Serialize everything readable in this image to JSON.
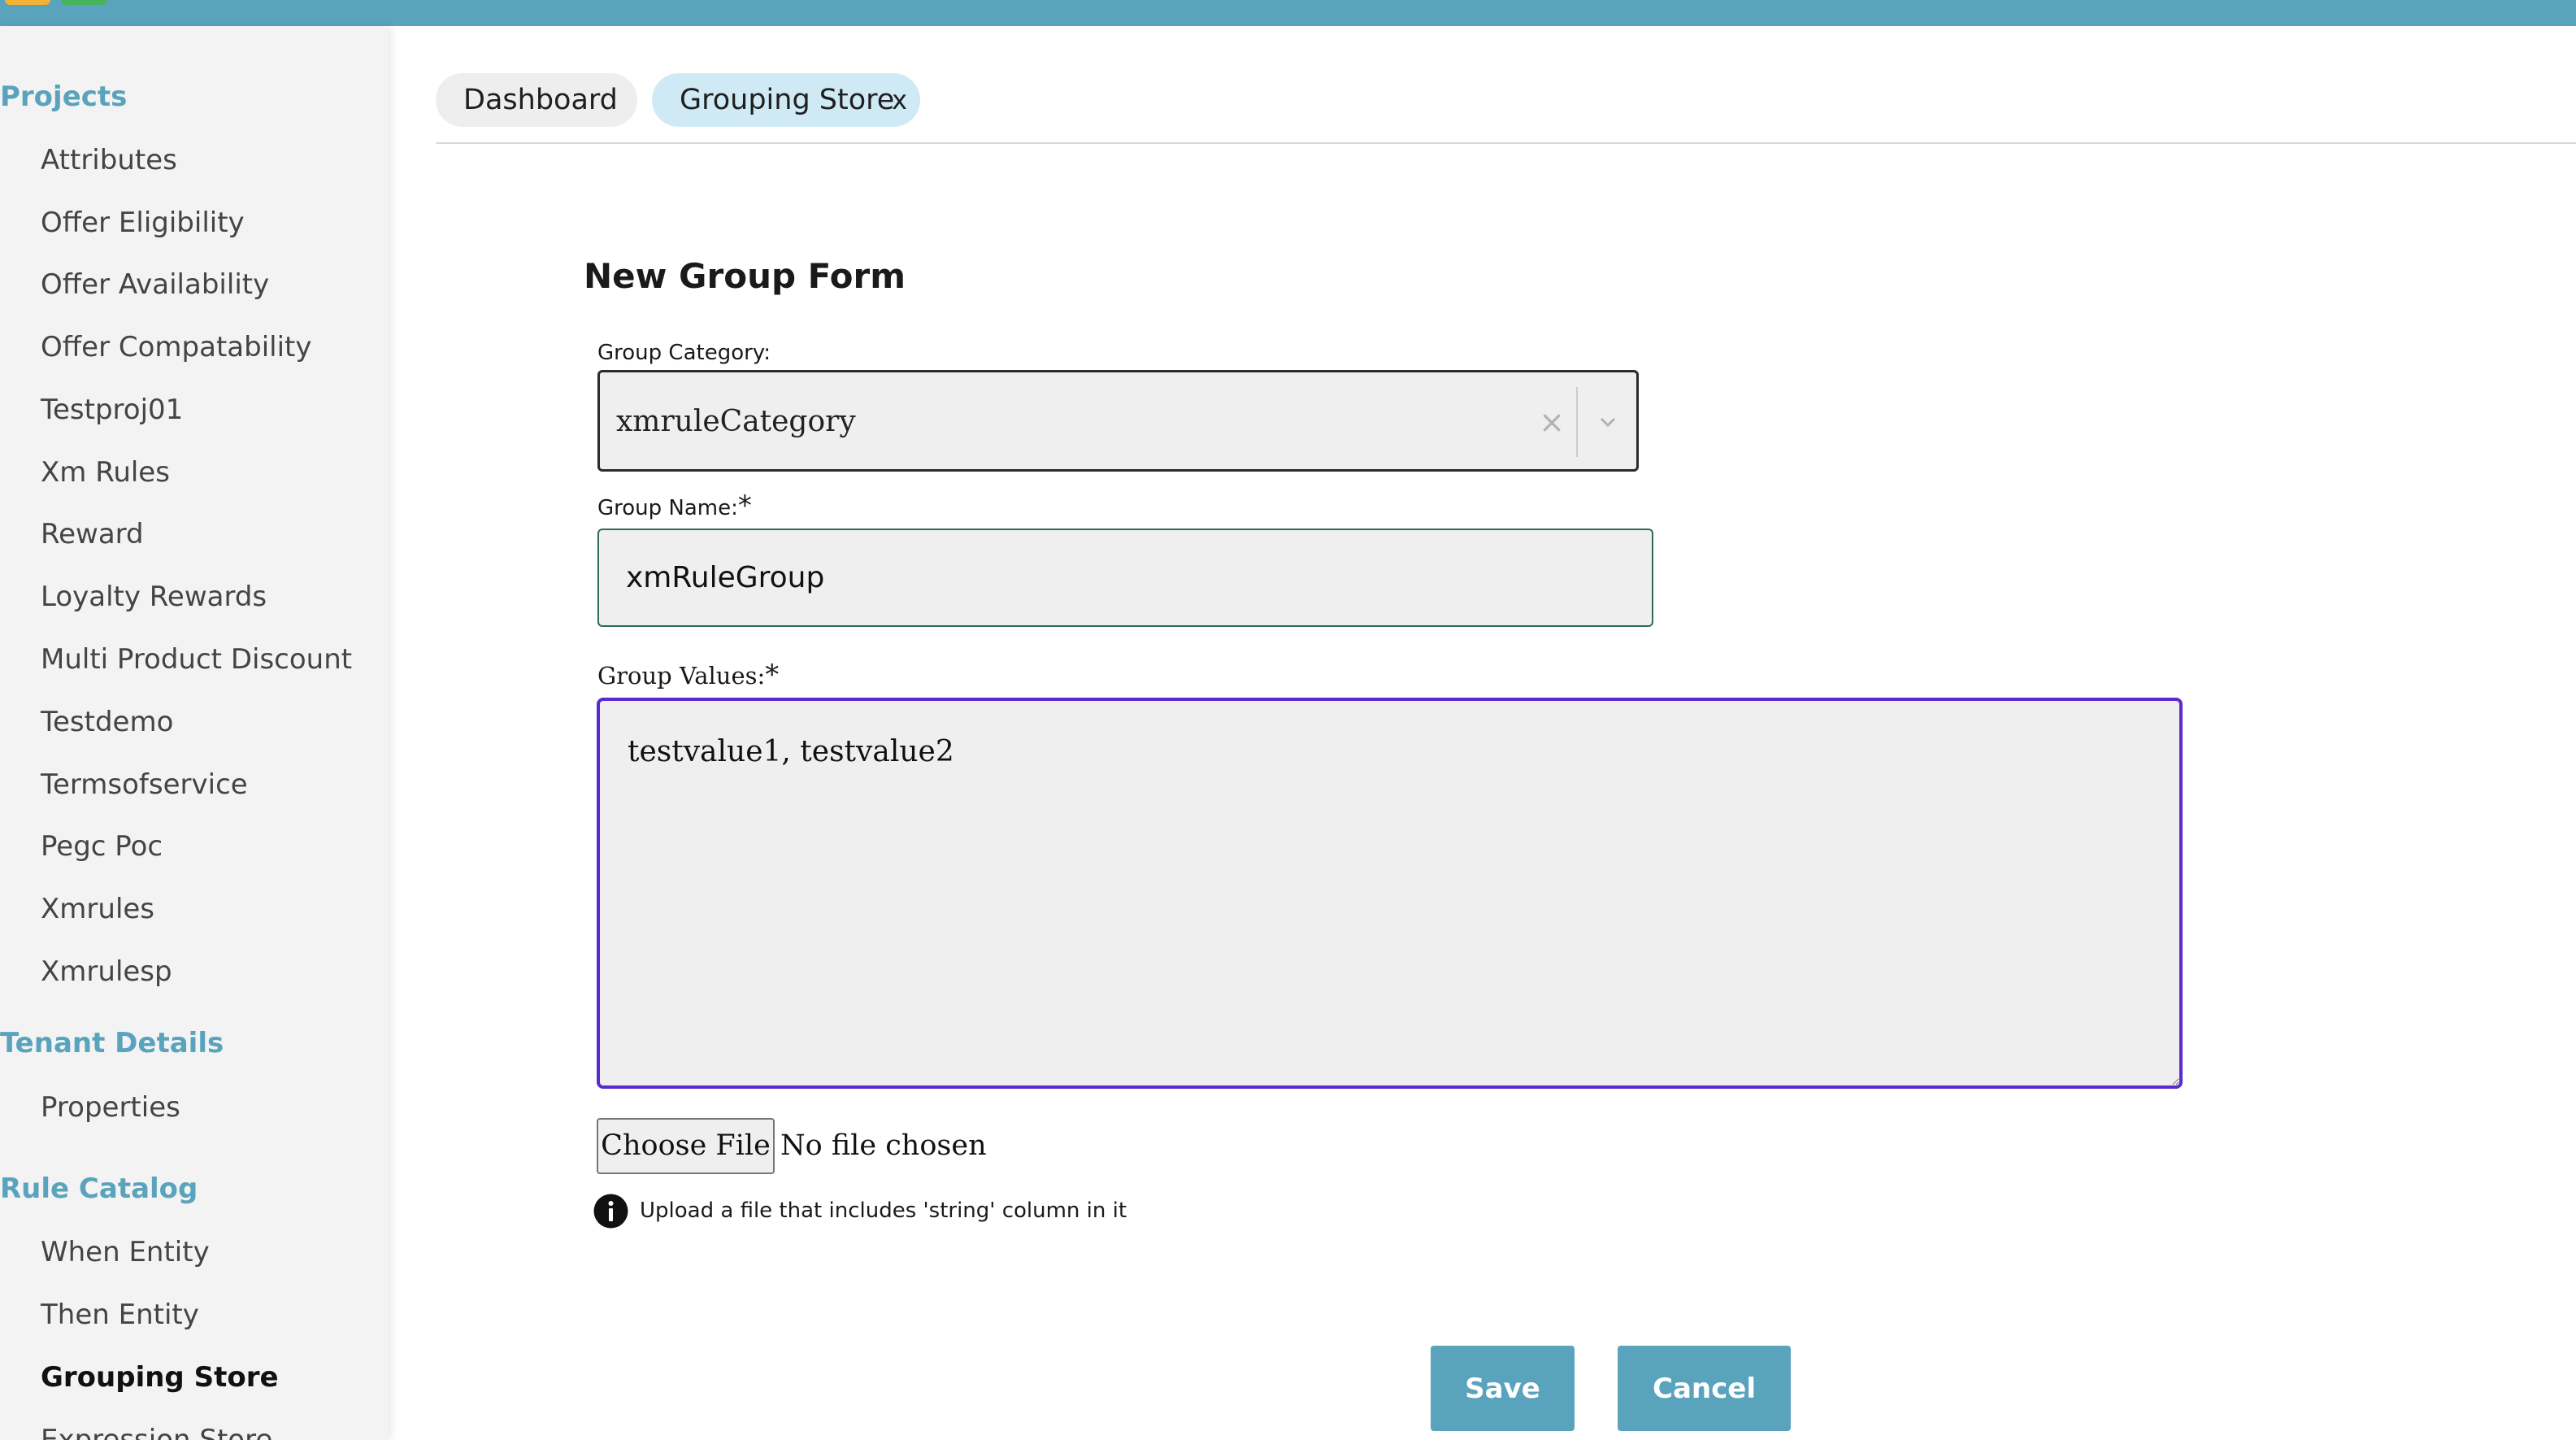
{
  "sidebar": {
    "sections": [
      {
        "label": "Projects"
      },
      {
        "label": "Tenant Details"
      },
      {
        "label": "Rule Catalog"
      }
    ],
    "projects": [
      {
        "label": "Attributes"
      },
      {
        "label": "Offer Eligibility"
      },
      {
        "label": "Offer Availability"
      },
      {
        "label": "Offer Compatability"
      },
      {
        "label": "Testproj01"
      },
      {
        "label": "Xm Rules"
      },
      {
        "label": "Reward"
      },
      {
        "label": "Loyalty Rewards"
      },
      {
        "label": "Multi Product Discount"
      },
      {
        "label": "Testdemo"
      },
      {
        "label": "Termsofservice"
      },
      {
        "label": "Pegc Poc"
      },
      {
        "label": "Xmrules"
      },
      {
        "label": "Xmrulesp"
      }
    ],
    "tenant": [
      {
        "label": "Properties"
      }
    ],
    "catalog": [
      {
        "label": "When Entity"
      },
      {
        "label": "Then Entity"
      },
      {
        "label": "Grouping Store",
        "active": true
      },
      {
        "label": "Expression Store"
      }
    ]
  },
  "tabs": [
    {
      "label": "Dashboard"
    },
    {
      "label": "Grouping Store",
      "close": "x"
    }
  ],
  "form": {
    "title": "New Group Form",
    "category_label": "Group Category:",
    "category_value": "xmruleCategory",
    "clear_glyph": "×",
    "name_label": "Group Name:",
    "required_mark": "*",
    "name_value": "xmRuleGroup",
    "values_label": "Group Values:",
    "values_value": "testvalue1, testvalue2",
    "file_button": "Choose File",
    "file_status": "No file chosen",
    "help_text": "Upload a file that includes 'string' column in it",
    "save_label": "Save",
    "cancel_label": "Cancel"
  },
  "colors": {
    "brand": "#5aa3bd",
    "active_tab": "#cfeaf4",
    "focus_border": "#5a2bd0"
  },
  "icons": {
    "close": "close-icon",
    "clear": "clear-icon",
    "dropdown": "chevron-down-icon",
    "info": "info-icon"
  }
}
